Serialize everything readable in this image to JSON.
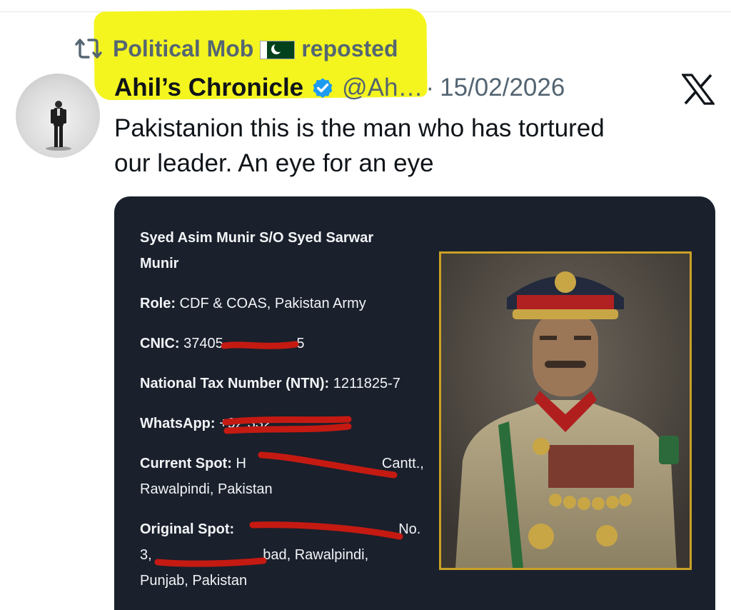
{
  "repost": {
    "reposter_name": "Political Mob",
    "flag": "pakistan-flag",
    "suffix": "reposted"
  },
  "tweet": {
    "display_name": "Ahil’s Chronicle",
    "handle": "@Ah…",
    "separator": "·",
    "date": "15/02/2026",
    "text_line1": "Pakistanion this is the man who has tortured",
    "text_line2": "our leader. An eye for an eye"
  },
  "card": {
    "name_line1": "Syed Asim Munir S/O Syed Sarwar",
    "name_line2": "Munir",
    "role_label": "Role:",
    "role_value": " CDF & COAS, Pakistan Army",
    "cnic_label": "CNIC:",
    "cnic_value": " 37405",
    "cnic_tail": "-5",
    "ntn_label": "National Tax Number (NTN):",
    "ntn_value": " 1211825-7",
    "whatsapp_label": "WhatsApp:",
    "whatsapp_value": " +92 332",
    "current_label": "Current Spot:",
    "current_value_start": " H",
    "current_value_end": "Cantt.,",
    "current_line2": "Rawalpindi, Pakistan",
    "original_label": "Original Spot:",
    "original_value_end": "No.",
    "original_line2_start": "3, ",
    "original_line2_end": "bad, Rawalpindi,",
    "original_line3": "Punjab, Pakistan"
  },
  "colors": {
    "highlight": "#f4f51f",
    "card_background": "#1a202c",
    "frame_gold": "#caa126",
    "verified_blue": "#1d9bf0",
    "redaction_red": "#c41a12"
  },
  "icons": {
    "repost": "repost-icon",
    "verified": "verified-badge-icon",
    "platform": "x-logo-icon"
  }
}
